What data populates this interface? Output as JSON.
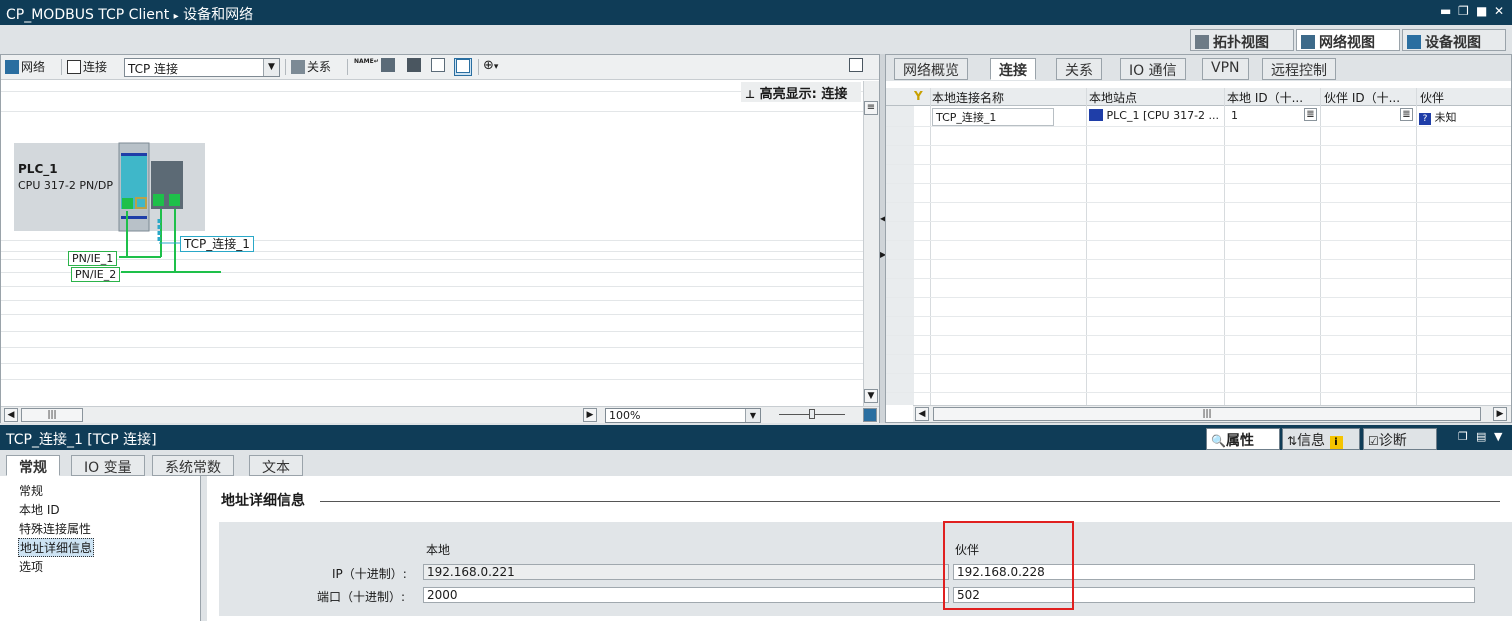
{
  "titlebar": {
    "project": "CP_MODBUS TCP Client",
    "separator": "▸",
    "page": "设备和网络"
  },
  "viewtabs": {
    "topology": "拓扑视图",
    "network": "网络视图",
    "device": "设备视图"
  },
  "left_toolbar": {
    "network_label": "网络",
    "connection_label": "连接",
    "connection_type": "TCP 连接",
    "relation_label": "关系",
    "name_badge": "NAME"
  },
  "canvas": {
    "highlight": "高亮显示: 连接",
    "plc_name": "PLC_1",
    "plc_cpu": "CPU 317-2 PN/DP",
    "net1": "PN/IE_1",
    "net2": "PN/IE_2",
    "connection": "TCP_连接_1",
    "zoom": "100%"
  },
  "right_tabs": [
    "网络概览",
    "连接",
    "关系",
    "IO 通信",
    "VPN",
    "远程控制"
  ],
  "table": {
    "headers": [
      "本地连接名称",
      "本地站点",
      "本地 ID（十...",
      "伙伴 ID（十...",
      "伙伴"
    ],
    "rows": [
      {
        "name": "TCP_连接_1",
        "station": "PLC_1 [CPU 317-2 ...",
        "local_id": "1",
        "partner_id": "",
        "partner": "未知"
      }
    ]
  },
  "inspector": {
    "title": "TCP_连接_1 [TCP 连接]",
    "tabs": {
      "properties": "属性",
      "info": "信息",
      "diagnostics": "诊断"
    },
    "prop_tabs": [
      "常规",
      "IO 变量",
      "系统常数",
      "文本"
    ],
    "nav": [
      "常规",
      "本地 ID",
      "特殊连接属性",
      "地址详细信息",
      "选项"
    ],
    "section_title": "地址详细信息",
    "col_local": "本地",
    "col_partner": "伙伴",
    "ip_label": "IP（十进制）:",
    "port_label": "端口（十进制）:",
    "local_ip": "192.168.0.221",
    "partner_ip": "192.168.0.228",
    "local_port": "2000",
    "partner_port": "502"
  }
}
